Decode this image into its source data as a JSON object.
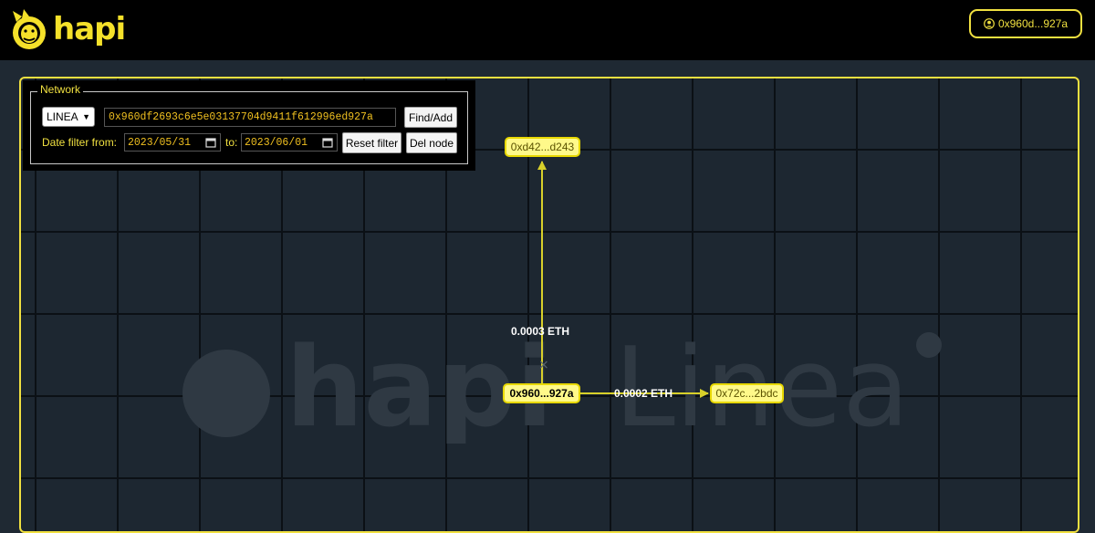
{
  "brand": {
    "logo_text": "hapi"
  },
  "header": {
    "wallet_label": "0x960d...927a"
  },
  "panel": {
    "legend": "Network",
    "network": "LINEA",
    "address": "0x960df2693c6e5e03137704d9411f612996ed927a",
    "find_add_label": "Find/Add",
    "date_filter_from_label": "Date filter from:",
    "date_from": "2023/05/31",
    "to_label": "to:",
    "date_to": "2023/06/01",
    "reset_filter_label": "Reset filter",
    "del_node_label": "Del node"
  },
  "graph": {
    "watermark_left": "hapi",
    "watermark_right": "Linea",
    "nodes": {
      "top": "0xd42...d243",
      "center": "0x960...927a",
      "right": "0x72c...2bdc"
    },
    "edges": {
      "to_top": "0.0003 ETH",
      "to_right": "0.0002 ETH"
    }
  },
  "colors": {
    "accent": "#f0e040",
    "node_fill": "#fff98a",
    "background": "#1f2933",
    "header": "#000000"
  }
}
